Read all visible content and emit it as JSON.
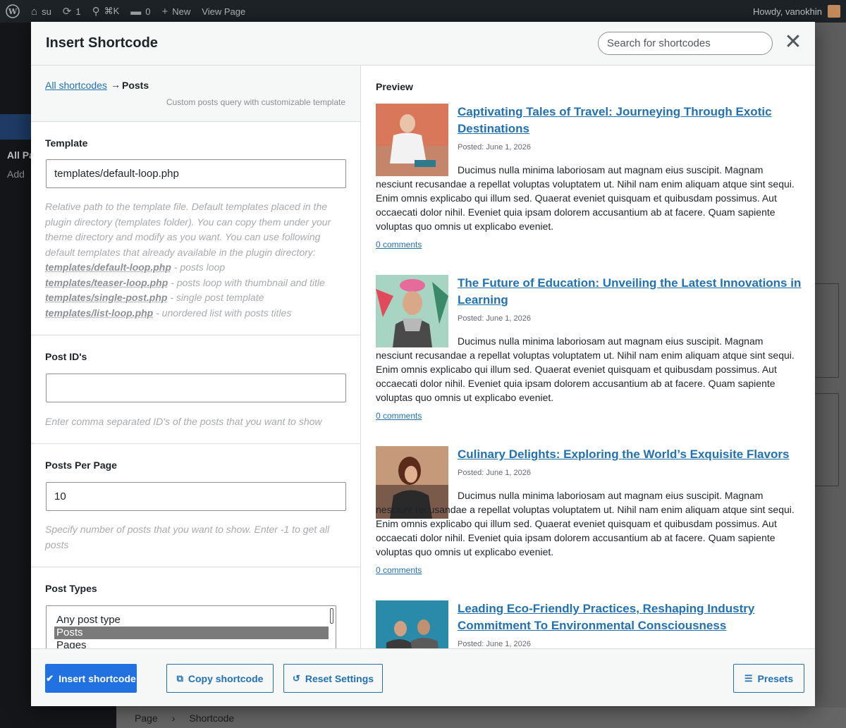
{
  "admin_bar": {
    "site_name": "su",
    "updates_count": "1",
    "search_shortcut": "⌘K",
    "comments_count": "0",
    "new_label": "New",
    "view_page_label": "View Page",
    "greeting": "Howdy, vanokhin"
  },
  "sidebar": {
    "all_pages": "All Pa",
    "add": "Add"
  },
  "bg_footer": {
    "crumb1": "Page",
    "crumb2": "Shortcode"
  },
  "modal": {
    "title": "Insert Shortcode",
    "search_placeholder": "Search for shortcodes",
    "close_glyph": "✕"
  },
  "breadcrumb": {
    "all_link": "All shortcodes",
    "arrow": "→",
    "current": "Posts",
    "description": "Custom posts query with customizable template"
  },
  "fields": {
    "template": {
      "label": "Template",
      "value": "templates/default-loop.php",
      "help_intro": "Relative path to the template file. Default templates placed in the plugin directory (templates folder). You can copy them under your theme directory and modify as you want. You can use following default templates that already available in the plugin directory:",
      "templates": [
        {
          "file": "templates/default-loop.php",
          "desc": " - posts loop"
        },
        {
          "file": "templates/teaser-loop.php",
          "desc": " - posts loop with thumbnail and title"
        },
        {
          "file": "templates/single-post.php",
          "desc": " - single post template"
        },
        {
          "file": "templates/list-loop.php",
          "desc": " - unordered list with posts titles"
        }
      ]
    },
    "post_ids": {
      "label": "Post ID's",
      "value": "",
      "help": "Enter comma separated ID's of the posts that you want to show"
    },
    "posts_per_page": {
      "label": "Posts Per Page",
      "value": "10",
      "help": "Specify number of posts that you want to show. Enter -1 to get all posts"
    },
    "post_types": {
      "label": "Post Types",
      "options": [
        "Any post type",
        "Posts",
        "Pages"
      ],
      "selected": "Posts"
    }
  },
  "preview": {
    "title": "Preview",
    "posts": [
      {
        "title": "Captivating Tales of Travel: Journeying Through Exotic Destinations",
        "date": "Posted: June 1, 2026",
        "excerpt": "Ducimus nulla minima laboriosam aut magnam eius suscipit. Magnam nesciunt recusandae a repellat voluptas voluptatem ut. Nihil nam enim aliquam atque sint sequi. Enim omnis explicabo qui illum sed. Quaerat eveniet quisquam et quibusdam possimus. Aut occaecati dolor nihil. Eveniet quia ipsam dolorem accusantium ab at facere. Quam sapiente voluptas quo omnis ut explicabo eveniet.",
        "comments": "0 comments"
      },
      {
        "title": "The Future of Education: Unveiling the Latest Innovations in Learning",
        "date": "Posted: June 1, 2026",
        "excerpt": "Ducimus nulla minima laboriosam aut magnam eius suscipit. Magnam nesciunt recusandae a repellat voluptas voluptatem ut. Nihil nam enim aliquam atque sint sequi. Enim omnis explicabo qui illum sed. Quaerat eveniet quisquam et quibusdam possimus. Aut occaecati dolor nihil. Eveniet quia ipsam dolorem accusantium ab at facere. Quam sapiente voluptas quo omnis ut explicabo eveniet.",
        "comments": "0 comments"
      },
      {
        "title": "Culinary Delights: Exploring the World’s Exquisite Flavors",
        "date": "Posted: June 1, 2026",
        "excerpt": "Ducimus nulla minima laboriosam aut magnam eius suscipit. Magnam nesciunt recusandae a repellat voluptas voluptatem ut. Nihil nam enim aliquam atque sint sequi. Enim omnis explicabo qui illum sed. Quaerat eveniet quisquam et quibusdam possimus. Aut occaecati dolor nihil. Eveniet quia ipsam dolorem accusantium ab at facere. Quam sapiente voluptas quo omnis ut explicabo eveniet.",
        "comments": "0 comments"
      },
      {
        "title": "Leading Eco-Friendly Practices, Reshaping Industry Commitment To Environmental Consciousness",
        "date": "Posted: June 1, 2026"
      }
    ]
  },
  "footer": {
    "insert_label": "Insert shortcode",
    "copy_label": "Copy shortcode",
    "reset_label": "Reset Settings",
    "presets_label": "Presets"
  },
  "colors": {
    "primary": "#2271e1",
    "link": "#2271b1"
  }
}
